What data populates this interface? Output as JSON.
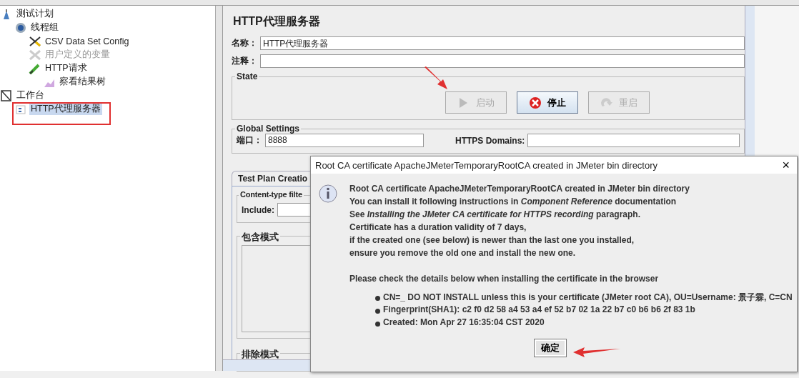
{
  "tree": [
    {
      "label": "测试计划",
      "kind": "plan",
      "selected": false,
      "disabled": false,
      "children": [
        {
          "label": "线程组",
          "kind": "threads",
          "selected": false,
          "disabled": false,
          "children": [
            {
              "label": "CSV Data Set Config",
              "kind": "config",
              "selected": false,
              "disabled": false
            },
            {
              "label": "用户定义的变量",
              "kind": "config",
              "selected": false,
              "disabled": true
            },
            {
              "label": "HTTP请求",
              "kind": "sampler",
              "selected": false,
              "disabled": false,
              "children": [
                {
                  "label": "察看结果树",
                  "kind": "listener",
                  "selected": false,
                  "disabled": false
                }
              ]
            }
          ]
        }
      ]
    },
    {
      "label": "工作台",
      "kind": "workbench",
      "selected": false,
      "disabled": false,
      "children": [
        {
          "label": "HTTP代理服务器",
          "kind": "proxy",
          "selected": true,
          "disabled": false
        }
      ]
    }
  ],
  "panel": {
    "title": "HTTP代理服务器",
    "name_label": "名称：",
    "name_value": "HTTP代理服务器",
    "comment_label": "注释：",
    "state": {
      "legend": "State",
      "buttons": [
        {
          "label": "启动",
          "kind": "start",
          "disabled": true
        },
        {
          "label": "停止",
          "kind": "stop",
          "disabled": false
        },
        {
          "label": "重启",
          "kind": "restart",
          "disabled": true
        }
      ]
    },
    "global": {
      "legend": "Global Settings",
      "port_label": "端口：",
      "port_value": "8888",
      "domains_label": "HTTPS Domains:"
    },
    "tabs": [
      {
        "label": "Test Plan Creatio",
        "selected": true
      }
    ],
    "content_filter": {
      "legend": "Content-type filte",
      "include_label": "Include:"
    },
    "include_legend": "包含模式",
    "exclude_legend": "排除模式"
  },
  "dialog": {
    "title": "Root CA certificate ApacheJMeterTemporaryRootCA created in JMeter bin directory",
    "close": "×",
    "lines": [
      "Root CA certificate ApacheJMeterTemporaryRootCA created in JMeter bin directory",
      "You can install it following instructions in *Component Reference* documentation",
      "See *Installing the JMeter CA certificate for HTTPS recording* paragraph.",
      "Certificate has a duration validity of 7 days,",
      "if the created one (see below) is newer than the last one you installed,",
      "ensure you remove the old one and install the new one."
    ],
    "note": "Please check the details below when installing the certificate in the browser",
    "details": [
      "CN=_ DO NOT INSTALL unless this is your certificate (JMeter root CA), OU=Username: 景子霖, C=CN",
      "Fingerprint(SHA1): c2 f0 d2 58 a4 53 a4 ef 52 b7 02 1a 22 b7 c0 b6 b6 2f 83 1b",
      "Created: Mon Apr 27 16:35:04 CST 2020"
    ],
    "ok": "确定"
  }
}
